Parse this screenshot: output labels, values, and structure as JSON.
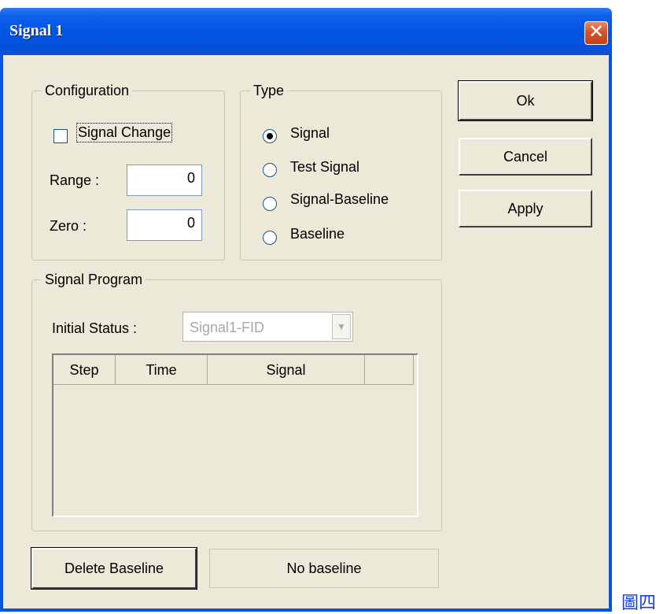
{
  "window": {
    "title": "Signal 1",
    "close_symbol": "✕"
  },
  "configuration": {
    "legend": "Configuration",
    "signal_change_label": "Signal Change",
    "signal_change_checked": false,
    "range_label": "Range :",
    "range_value": "0",
    "zero_label": "Zero :",
    "zero_value": "0"
  },
  "type": {
    "legend": "Type",
    "options": [
      "Signal",
      "Test Signal",
      "Signal-Baseline",
      "Baseline"
    ],
    "selected": "Signal"
  },
  "buttons": {
    "ok": "Ok",
    "cancel": "Cancel",
    "apply": "Apply",
    "delete_baseline": "Delete Baseline"
  },
  "program": {
    "legend": "Signal Program",
    "initial_status_label": "Initial Status :",
    "initial_status_value": "Signal1-FID",
    "columns": [
      "Step",
      "Time",
      "Signal",
      ""
    ],
    "rows": []
  },
  "status": {
    "baseline": "No baseline"
  },
  "caption": "圖四",
  "colors": {
    "titlebar": "#0054e3",
    "dialog_bg": "#ece9d8",
    "caption": "#1a3fd8"
  }
}
